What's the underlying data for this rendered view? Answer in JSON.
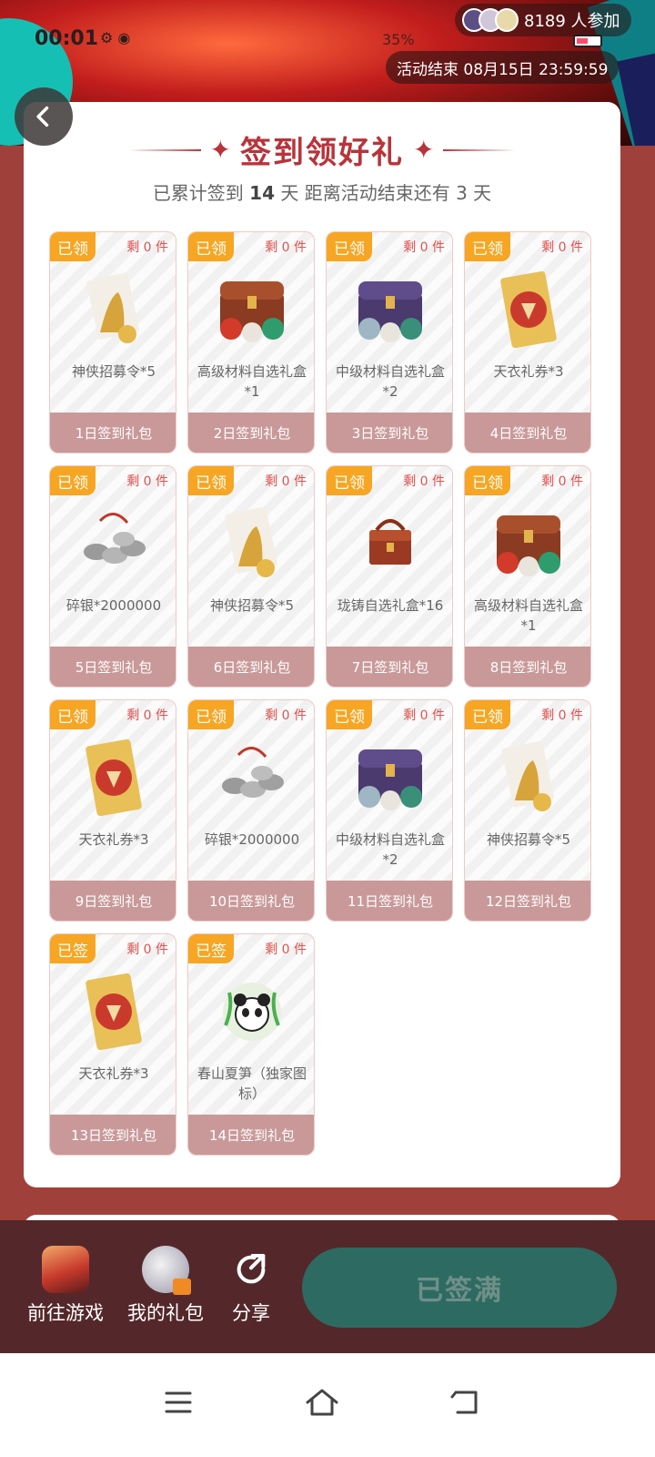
{
  "status_bar": {
    "time": "00:01",
    "battery": "35%"
  },
  "header": {
    "participants": "8189 人参加",
    "end_time": "活动结束 08月15日 23:59:59"
  },
  "card": {
    "title": "签到领好礼",
    "subtitle_prefix": "已累计签到",
    "days": "14",
    "subtitle_suffix": "天  距离活动结束还有 3 天"
  },
  "gifts": [
    {
      "badge": "已领",
      "remain": "剩 0 件",
      "name": "神侠招募令*5",
      "day": "1日签到礼包",
      "icon": "scroll-icon"
    },
    {
      "badge": "已领",
      "remain": "剩 0 件",
      "name": "高级材料自选礼盒*1",
      "day": "2日签到礼包",
      "icon": "red-chest-icon"
    },
    {
      "badge": "已领",
      "remain": "剩 0 件",
      "name": "中级材料自选礼盒*2",
      "day": "3日签到礼包",
      "icon": "purple-chest-icon"
    },
    {
      "badge": "已领",
      "remain": "剩 0 件",
      "name": "天衣礼券*3",
      "day": "4日签到礼包",
      "icon": "ticket-icon"
    },
    {
      "badge": "已领",
      "remain": "剩 0 件",
      "name": "碎银*2000000",
      "day": "5日签到礼包",
      "icon": "coins-icon"
    },
    {
      "badge": "已领",
      "remain": "剩 0 件",
      "name": "神侠招募令*5",
      "day": "6日签到礼包",
      "icon": "scroll-icon"
    },
    {
      "badge": "已领",
      "remain": "剩 0 件",
      "name": "珑铸自选礼盒*16",
      "day": "7日签到礼包",
      "icon": "small-box-icon"
    },
    {
      "badge": "已领",
      "remain": "剩 0 件",
      "name": "高级材料自选礼盒*1",
      "day": "8日签到礼包",
      "icon": "red-chest-icon"
    },
    {
      "badge": "已领",
      "remain": "剩 0 件",
      "name": "天衣礼券*3",
      "day": "9日签到礼包",
      "icon": "ticket-icon"
    },
    {
      "badge": "已领",
      "remain": "剩 0 件",
      "name": "碎银*2000000",
      "day": "10日签到礼包",
      "icon": "coins-icon"
    },
    {
      "badge": "已领",
      "remain": "剩 0 件",
      "name": "中级材料自选礼盒*2",
      "day": "11日签到礼包",
      "icon": "purple-chest-icon"
    },
    {
      "badge": "已领",
      "remain": "剩 0 件",
      "name": "神侠招募令*5",
      "day": "12日签到礼包",
      "icon": "scroll-icon"
    },
    {
      "badge": "已签",
      "remain": "剩 0 件",
      "name": "天衣礼券*3",
      "day": "13日签到礼包",
      "icon": "ticket-icon"
    },
    {
      "badge": "已签",
      "remain": "剩 0 件",
      "name": "春山夏笋（独家图标）",
      "day": "14日签到礼包",
      "icon": "panda-avatar-icon"
    }
  ],
  "bottom_bar": {
    "go_game": "前往游戏",
    "my_gifts": "我的礼包",
    "share": "分享",
    "signed_full": "已签满"
  },
  "colors": {
    "accent": "#b8343a",
    "badge": "#f6a623",
    "day_button": "#c99999",
    "primary_button": "#2d6b62"
  }
}
